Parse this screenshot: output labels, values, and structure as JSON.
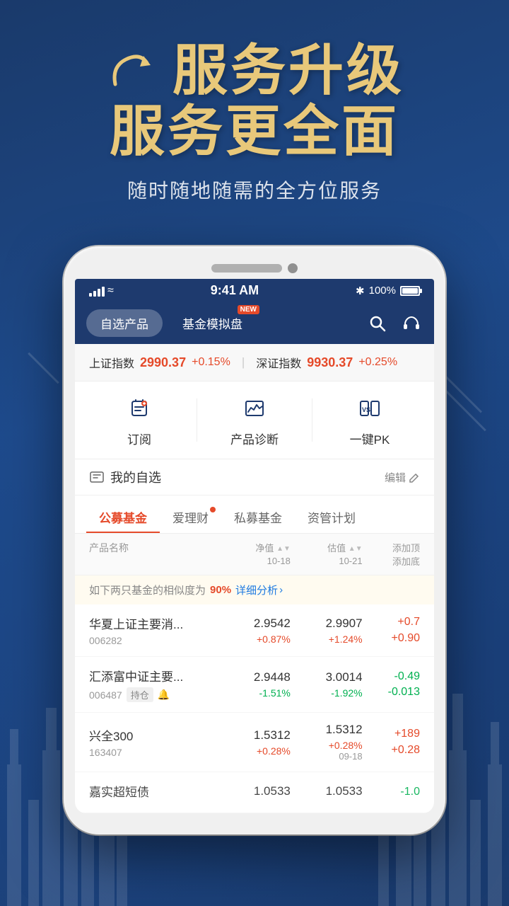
{
  "header": {
    "title_line1": "服务升级",
    "title_line2": "服务更全面",
    "subtitle": "随时随地随需的全方位服务"
  },
  "phone": {
    "status_bar": {
      "time": "9:41 AM",
      "battery": "100%",
      "bluetooth": "bluetooth"
    },
    "nav": {
      "tab1": "自选产品",
      "tab2": "基金模拟盘",
      "new_badge": "NEW"
    },
    "ticker": {
      "sh_label": "上证指数",
      "sh_value": "2990.37",
      "sh_change": "+0.15%",
      "sz_label": "深证指数",
      "sz_value": "9930.37",
      "sz_change": "+0.25%"
    },
    "quick_actions": [
      {
        "icon": "bell",
        "label": "订阅"
      },
      {
        "icon": "chart",
        "label": "产品诊断"
      },
      {
        "icon": "vs",
        "label": "一键PK"
      }
    ],
    "watchlist": {
      "title": "我的自选",
      "edit_label": "编辑"
    },
    "cat_tabs": [
      {
        "label": "公募基金",
        "active": true,
        "dot": false
      },
      {
        "label": "爱理财",
        "active": false,
        "dot": true
      },
      {
        "label": "私募基金",
        "active": false,
        "dot": false
      },
      {
        "label": "资管计划",
        "active": false,
        "dot": false
      }
    ],
    "table_header": {
      "name": "产品名称",
      "nav": "净值",
      "nav_date": "10-18",
      "est": "估值",
      "est_date": "10-21",
      "add_top": "添加顶",
      "add_bottom": "添加底"
    },
    "similarity": {
      "text": "如下两只基金的相似度为",
      "pct": "90%",
      "link": "详细分析"
    },
    "funds": [
      {
        "name": "华夏上证主要消...",
        "code": "006282",
        "tag": "",
        "nav": "2.9542",
        "nav_change": "+0.87%",
        "nav_up": true,
        "est": "2.9907",
        "est_change": "+1.24%",
        "est_up": true,
        "return": "+0.7",
        "return2": "+0.90",
        "return_up": true
      },
      {
        "name": "汇添富中证主要...",
        "code": "006487",
        "tag": "持仓",
        "nav": "2.9448",
        "nav_change": "-1.51%",
        "nav_up": false,
        "est": "3.0014",
        "est_change": "-1.92%",
        "est_up": false,
        "return": "-0.49",
        "return2": "-0.013",
        "return_up": false
      },
      {
        "name": "兴全300",
        "code": "163407",
        "tag": "",
        "nav": "1.5312",
        "nav_change": "+0.28%",
        "nav_up": true,
        "est": "1.5312",
        "est_change": "+0.28%",
        "est_up": true,
        "return": "+189",
        "return2": "+0.28",
        "date": "09-18",
        "return_up": true
      },
      {
        "name": "嘉实超短债",
        "code": "",
        "tag": "",
        "nav": "1.0533",
        "nav_change": "",
        "est": "1.0533",
        "est_change": "",
        "return": "-1.0",
        "return_up": false
      }
    ]
  }
}
